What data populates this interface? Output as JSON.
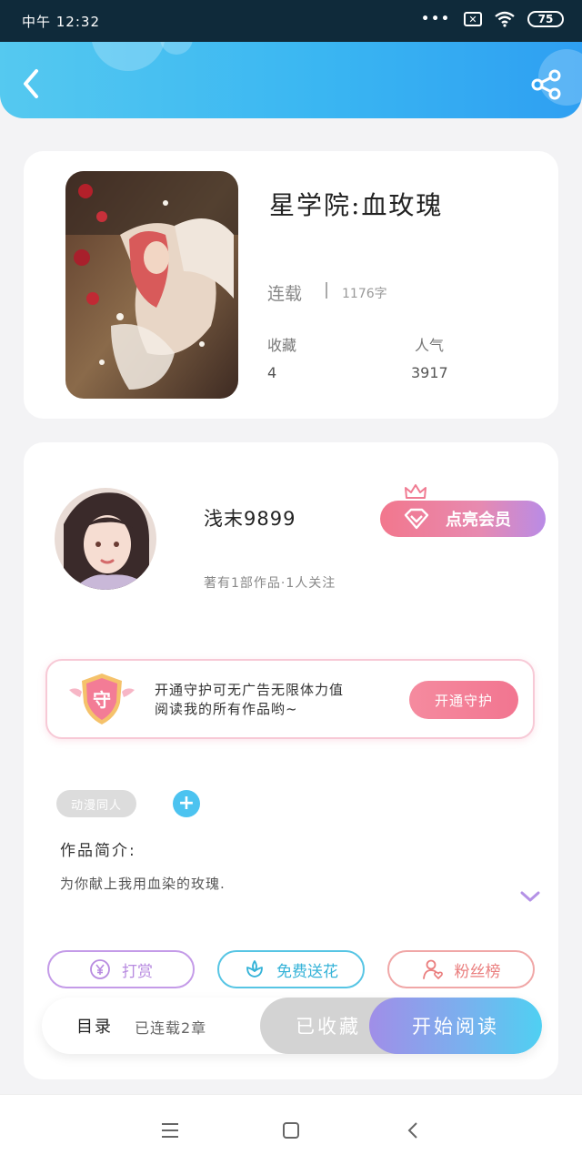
{
  "status_bar": {
    "time": "中午 12:32",
    "battery": "75",
    "signal_dots": "•••",
    "sim": "✕"
  },
  "book": {
    "title": "星学院:血玫瑰",
    "status": "连载",
    "word_count": "1176字",
    "stats": [
      {
        "label": "收藏",
        "value": "4"
      },
      {
        "label": "人气",
        "value": "3917"
      }
    ]
  },
  "author": {
    "name": "浅末9899",
    "meta": "著有1部作品·1人关注",
    "vip_label": "点亮会员"
  },
  "guard": {
    "badge": "守",
    "line1": "开通守护可无广告无限体力值",
    "line2": "阅读我的所有作品哟~",
    "button": "开通守护"
  },
  "tags": [
    "动漫同人"
  ],
  "add_tag": "+",
  "intro": {
    "label": "作品简介:",
    "text": "为你献上我用血染的玫瑰."
  },
  "actions": {
    "reward": "打赏",
    "flower": "免费送花",
    "fans": "粉丝榜"
  },
  "bottom_bar": {
    "toc": "目录",
    "toc_info": "已连载2章",
    "collected": "已收藏",
    "read": "开始阅读"
  },
  "colors": {
    "header": "#3ab6f2",
    "accent_pink": "#f2778d",
    "accent_blue": "#4cc3f0",
    "accent_purple": "#b98be6"
  }
}
